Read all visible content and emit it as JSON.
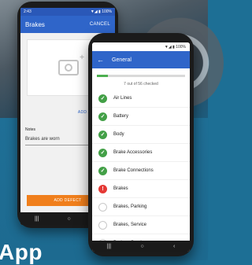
{
  "background_title": "App",
  "left_phone": {
    "status_time": "2:43",
    "status_icons": "▼◢ ▮ 100%",
    "title": "Brakes",
    "cancel_label": "CANCEL",
    "add_photo_label": "ADD A PHOTO",
    "notes_label": "Notes",
    "notes_value": "Brakes are worn",
    "add_defect_label": "ADD DEFECT",
    "nav": [
      "|||",
      "○",
      "‹"
    ]
  },
  "right_phone": {
    "status_icons": "▼◢ ▮ 100%",
    "title": "General",
    "progress_text": "7 out of 56 checked",
    "progress_fraction": 0.125,
    "items": [
      {
        "label": "Air Lines",
        "status": "ok"
      },
      {
        "label": "Battery",
        "status": "ok"
      },
      {
        "label": "Body",
        "status": "ok"
      },
      {
        "label": "Brake Accessories",
        "status": "ok"
      },
      {
        "label": "Brake Connections",
        "status": "ok"
      },
      {
        "label": "Brakes",
        "status": "defect"
      },
      {
        "label": "Brakes, Parking",
        "status": "pending"
      },
      {
        "label": "Brakes, Service",
        "status": "pending"
      },
      {
        "label": "Brakes, Service",
        "status": "pending"
      }
    ],
    "nav": [
      "|||",
      "○",
      "‹"
    ]
  },
  "colors": {
    "primary": "#2f65c9",
    "accent": "#f07f1c",
    "ok": "#43a047",
    "defect": "#e53935"
  }
}
